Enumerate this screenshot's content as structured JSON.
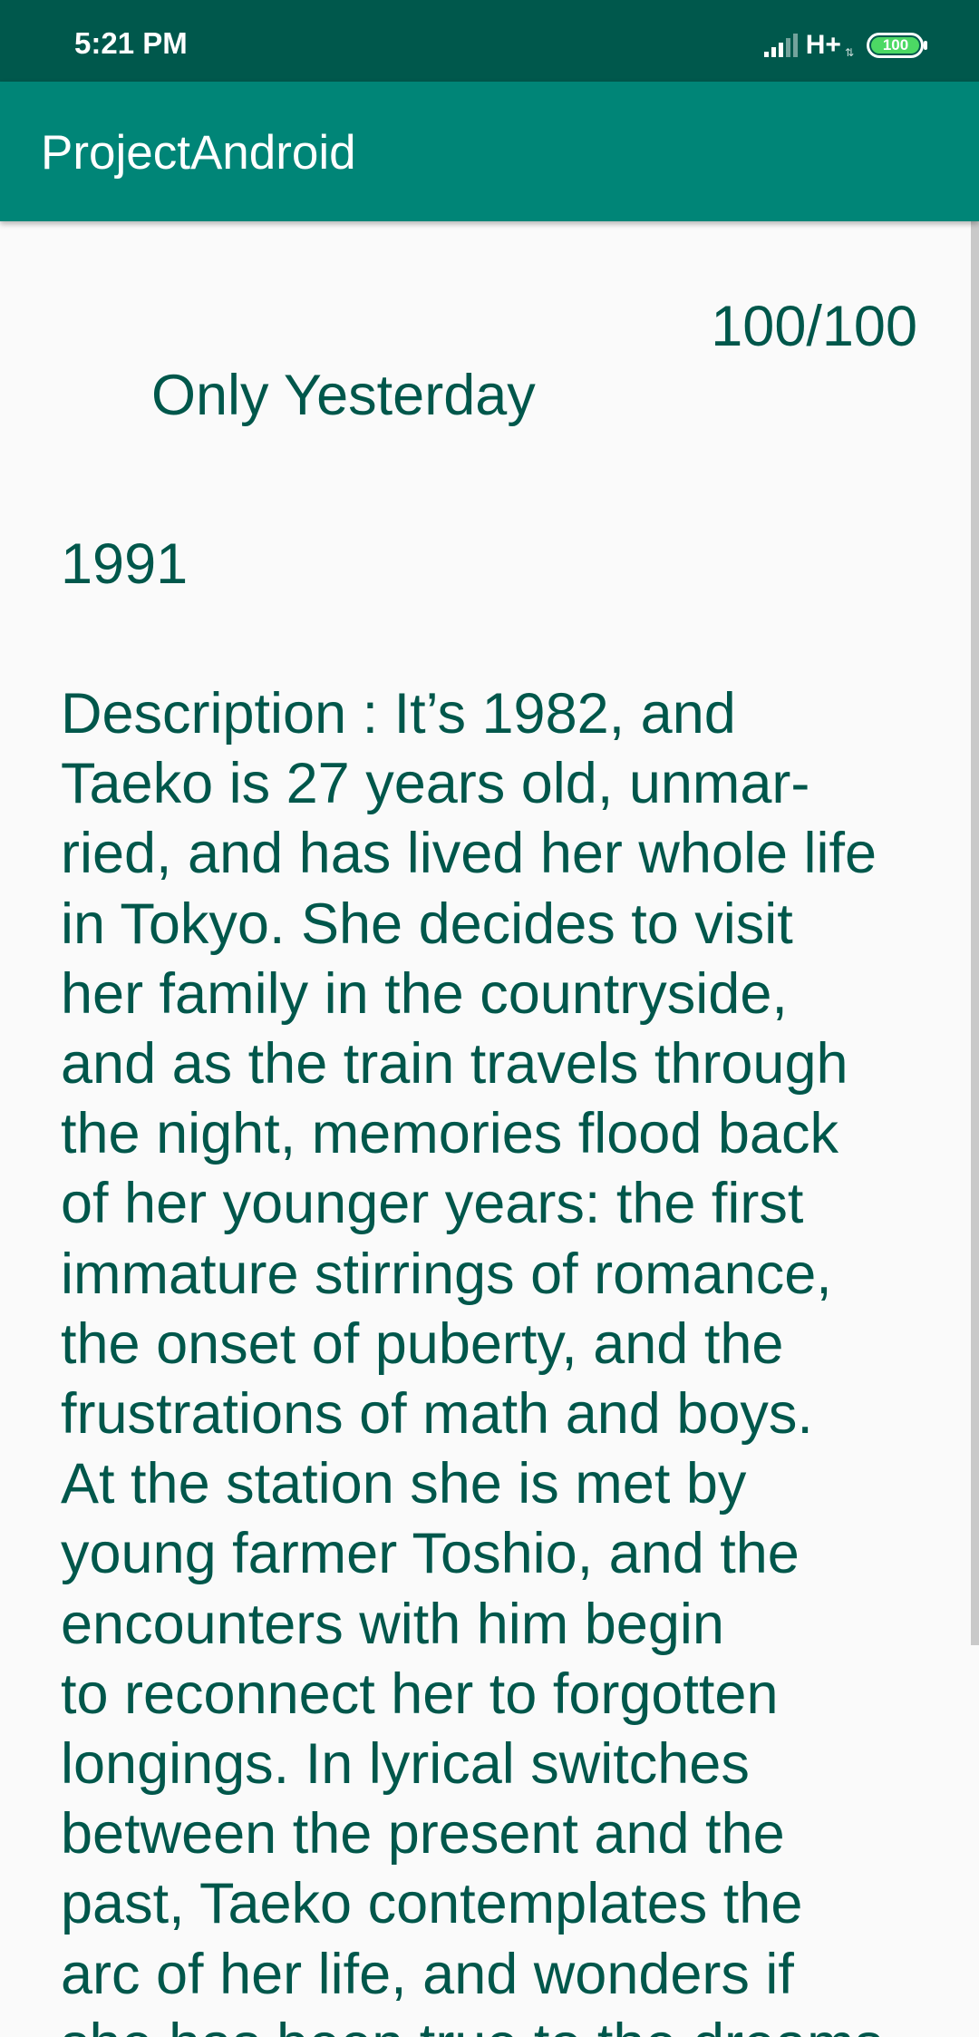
{
  "status_bar": {
    "time": "5:21 PM",
    "network": "H+",
    "battery": "100",
    "signal_icon": "cellular-signal-icon",
    "battery_icon": "battery-icon",
    "battery_color": "#4cd964"
  },
  "app_bar": {
    "title": "ProjectAndroid",
    "color": "#008577"
  },
  "movie": {
    "rating": "100/100",
    "title": "Only Yesterday",
    "year": "1991",
    "description": "Description : It’s 1982, and\nTaeko is 27 years old, unmar-\nried, and has lived her whole life\nin Tokyo. She decides to visit\nher family in the countryside,\nand as the train travels through\nthe night, memories flood back\nof her younger years: the first\nimmature stirrings of romance,\nthe onset of puberty, and the\nfrustrations of math and boys.\nAt the station she is met by\nyoung farmer Toshio, and the\nencounters with him begin\nto reconnect her to forgotten\nlongings. In lyrical switches\nbetween the present and the\npast, Taeko contemplates the\narc of her life, and wonders if\nshe has been true to the dreams",
    "text_color": "#00574b"
  }
}
